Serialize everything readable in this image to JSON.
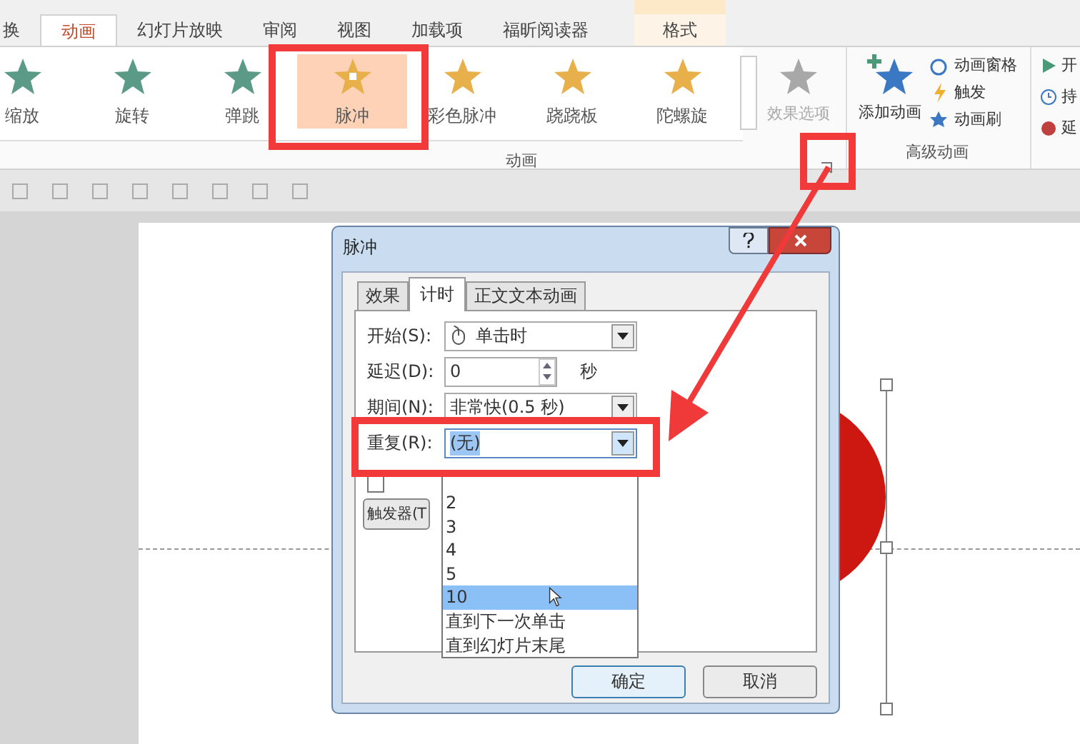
{
  "ribbon_tabs": [
    {
      "label": "换",
      "selected": false
    },
    {
      "label": "动画",
      "selected": true
    },
    {
      "label": "幻灯片放映",
      "selected": false
    },
    {
      "label": "审阅",
      "selected": false
    },
    {
      "label": "视图",
      "selected": false
    },
    {
      "label": "加载项",
      "selected": false
    },
    {
      "label": "福昕阅读器",
      "selected": false
    },
    {
      "label": "格式",
      "selected": false,
      "kind": "contextual"
    }
  ],
  "animation_gallery": {
    "group_label": "动画",
    "items": [
      {
        "label": "缩放",
        "selected": false,
        "color": "#5a9a86"
      },
      {
        "label": "旋转",
        "selected": false,
        "color": "#5a9a86"
      },
      {
        "label": "弹跳",
        "selected": false,
        "color": "#5a9a86"
      },
      {
        "label": "脉冲",
        "selected": true,
        "color": "#e8b04a"
      },
      {
        "label": "彩色脉冲",
        "selected": false,
        "color": "#e8b04a"
      },
      {
        "label": "跷跷板",
        "selected": false,
        "color": "#e8b04a"
      },
      {
        "label": "陀螺旋",
        "selected": false,
        "color": "#e8b04a"
      }
    ]
  },
  "effect_options": {
    "label": "效果选项",
    "disabled": true
  },
  "advanced_animation": {
    "group_label": "高级动画",
    "add_animation": "添加动画",
    "items": [
      "动画窗格",
      "触发",
      "动画刷"
    ]
  },
  "timing_group": {
    "items": [
      "开",
      "持",
      "延"
    ]
  },
  "dialog": {
    "title": "脉冲",
    "tabs": [
      {
        "label": "效果",
        "selected": false
      },
      {
        "label": "计时",
        "selected": true
      },
      {
        "label": "正文文本动画",
        "selected": false
      }
    ],
    "start": {
      "label": "开始(S):",
      "value": "单击时"
    },
    "delay": {
      "label": "延迟(D):",
      "value": "0",
      "unit": "秒"
    },
    "duration": {
      "label": "期间(N):",
      "value": "非常快(0.5 秒)"
    },
    "repeat": {
      "label": "重复(R):",
      "value": "(无)",
      "options": [
        {
          "label": "2",
          "selected": false
        },
        {
          "label": "3",
          "selected": false
        },
        {
          "label": "4",
          "selected": false
        },
        {
          "label": "5",
          "selected": false
        },
        {
          "label": "10",
          "selected": true
        },
        {
          "label": "直到下一次单击",
          "selected": false
        },
        {
          "label": "直到幻灯片末尾",
          "selected": false
        }
      ]
    },
    "rewind": {
      "checked": false
    },
    "trigger_button": "触发器(T",
    "ok": "确定",
    "cancel": "取消"
  }
}
